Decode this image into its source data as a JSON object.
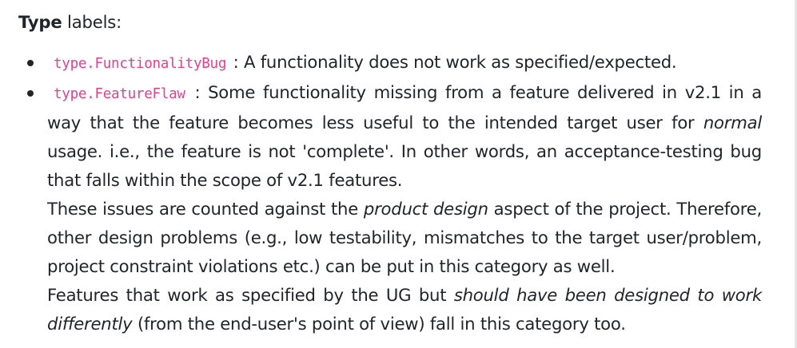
{
  "heading": {
    "bold": "Type",
    "rest": " labels:"
  },
  "items": [
    {
      "label": "type.FunctionalityBug",
      "description": " : A functionality does not work as specified/expected."
    },
    {
      "label": "type.FeatureFlaw",
      "p1_a": " : Some functionality missing from a feature delivered in v2.1 in a way that the feature becomes less useful to the intended target user for ",
      "p1_em": "normal",
      "p1_b": " usage. i.e., the feature is not 'complete'. In other words, an acceptance-testing bug that falls within the scope of v2.1 features.",
      "p2_a": "These issues are counted against the ",
      "p2_em": "product design",
      "p2_b": " aspect of the project. Therefore, other design problems (e.g., low testability, mismatches to the target user/problem, project constraint violations etc.) can be put in this category as well.",
      "p3_a": "Features that work as specified by the UG but ",
      "p3_em": "should have been designed to work differently",
      "p3_b": " (from the end-user's point of view) fall in this category too."
    }
  ]
}
